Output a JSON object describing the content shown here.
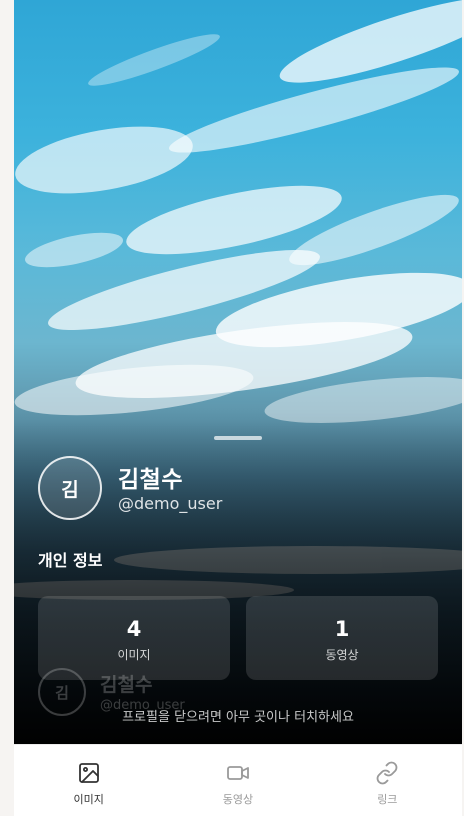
{
  "profile": {
    "avatar_initial": "김",
    "name": "김철수",
    "username": "@demo_user"
  },
  "section": {
    "title": "개인 정보"
  },
  "stats": [
    {
      "count": "4",
      "label": "이미지"
    },
    {
      "count": "1",
      "label": "동영상"
    }
  ],
  "hint": "프로필을 닫으려면 아무 곳이나 터치하세요",
  "tabs": [
    {
      "label": "이미지",
      "icon": "image-icon",
      "active": true
    },
    {
      "label": "동영상",
      "icon": "video-icon",
      "active": false
    },
    {
      "label": "링크",
      "icon": "link-icon",
      "active": false
    }
  ],
  "colors": {
    "active_tab": "#333333",
    "inactive_tab": "#9a9a9a",
    "sky": "#3cb2dc"
  }
}
